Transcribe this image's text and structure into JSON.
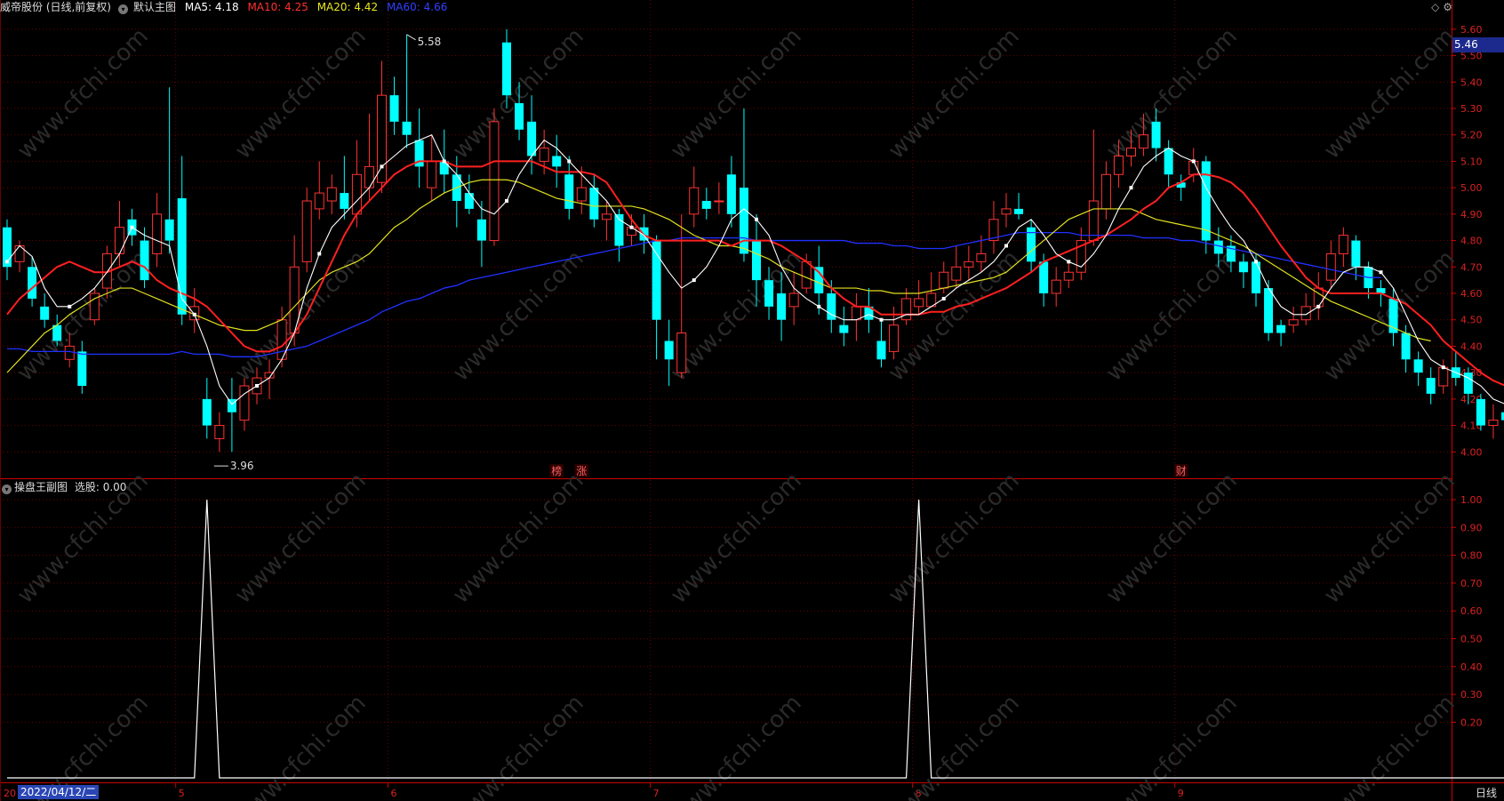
{
  "header": {
    "stock_title": "威帝股份 (日线,前复权)",
    "template": "默认主图",
    "ma5_label": "MA5: 4.18",
    "ma10_label": "MA10: 4.25",
    "ma20_label": "MA20: 4.42",
    "ma60_label": "MA60: 4.66"
  },
  "sub": {
    "title": "操盘王副图",
    "value_label": "选股: 0.00"
  },
  "price_box": "5.46",
  "extremes": {
    "high": "5.58",
    "low": "3.96"
  },
  "events": [
    "榜",
    "涨",
    "财"
  ],
  "date_axis": {
    "selected": "2022/04/12/二",
    "months": [
      "5",
      "6",
      "7",
      "8",
      "9"
    ],
    "left_stub": "20"
  },
  "period": "日线",
  "watermark": "www.cfchi.com",
  "colors": {
    "up": "#ff3333",
    "down": "#00ffff",
    "ma5": "#ffffff",
    "ma10": "#ff2020",
    "ma20": "#e0e020",
    "ma60": "#2030ff",
    "grid": "#6b0000"
  },
  "price_axis": [
    "5.60",
    "5.50",
    "5.40",
    "5.30",
    "5.20",
    "5.10",
    "5.00",
    "4.90",
    "4.80",
    "4.70",
    "4.60",
    "4.50",
    "4.40",
    "4.30",
    "4.20",
    "4.10",
    "4.00"
  ],
  "sub_axis": [
    "1.00",
    "0.90",
    "0.80",
    "0.70",
    "0.60",
    "0.50",
    "0.40",
    "0.30",
    "0.20"
  ],
  "chart_data": {
    "type": "candlestick",
    "ylim": [
      3.9,
      5.65
    ],
    "candles": [
      [
        4.85,
        4.7,
        4.88,
        4.65
      ],
      [
        4.72,
        4.78,
        4.8,
        4.68
      ],
      [
        4.7,
        4.58,
        4.74,
        4.55
      ],
      [
        4.55,
        4.5,
        4.6,
        4.47
      ],
      [
        4.48,
        4.42,
        4.52,
        4.4
      ],
      [
        4.35,
        4.4,
        4.45,
        4.32
      ],
      [
        4.38,
        4.25,
        4.42,
        4.22
      ],
      [
        4.5,
        4.6,
        4.62,
        4.48
      ],
      [
        4.62,
        4.75,
        4.78,
        4.58
      ],
      [
        4.75,
        4.85,
        4.95,
        4.7
      ],
      [
        4.88,
        4.82,
        4.92,
        4.78
      ],
      [
        4.8,
        4.65,
        4.85,
        4.62
      ],
      [
        4.75,
        4.9,
        4.98,
        4.7
      ],
      [
        4.88,
        4.8,
        5.38,
        4.75
      ],
      [
        4.96,
        4.52,
        5.12,
        4.48
      ],
      [
        4.5,
        4.55,
        4.62,
        4.45
      ],
      [
        4.2,
        4.1,
        4.28,
        4.05
      ],
      [
        4.05,
        4.1,
        4.15,
        4.0
      ],
      [
        4.2,
        4.15,
        4.28,
        4.0
      ],
      [
        4.12,
        4.25,
        4.28,
        4.08
      ],
      [
        4.22,
        4.28,
        4.32,
        4.18
      ],
      [
        4.28,
        4.3,
        4.35,
        4.2
      ],
      [
        4.35,
        4.5,
        4.55,
        4.32
      ],
      [
        4.45,
        4.7,
        4.82,
        4.4
      ],
      [
        4.72,
        4.95,
        5.0,
        4.68
      ],
      [
        4.92,
        4.98,
        5.1,
        4.88
      ],
      [
        4.95,
        5.0,
        5.05,
        4.9
      ],
      [
        4.98,
        4.92,
        5.12,
        4.88
      ],
      [
        4.9,
        5.05,
        5.18,
        4.85
      ],
      [
        5.0,
        5.08,
        5.28,
        4.95
      ],
      [
        5.02,
        5.35,
        5.48,
        4.98
      ],
      [
        5.35,
        5.25,
        5.42,
        5.2
      ],
      [
        5.25,
        5.2,
        5.58,
        5.15
      ],
      [
        5.18,
        5.08,
        5.3,
        5.0
      ],
      [
        5.0,
        5.1,
        5.2,
        4.95
      ],
      [
        5.1,
        5.05,
        5.22,
        4.98
      ],
      [
        5.05,
        4.95,
        5.12,
        4.85
      ],
      [
        4.98,
        4.92,
        5.05,
        4.9
      ],
      [
        4.88,
        4.8,
        4.95,
        4.7
      ],
      [
        4.8,
        5.25,
        5.3,
        4.78
      ],
      [
        5.55,
        5.35,
        5.6,
        5.3
      ],
      [
        5.32,
        5.22,
        5.4,
        5.18
      ],
      [
        5.25,
        5.12,
        5.35,
        5.05
      ],
      [
        5.1,
        5.15,
        5.22,
        5.05
      ],
      [
        5.12,
        5.08,
        5.2,
        5.0
      ],
      [
        5.05,
        4.92,
        5.12,
        4.88
      ],
      [
        4.95,
        5.0,
        5.08,
        4.9
      ],
      [
        5.0,
        4.88,
        5.05,
        4.85
      ],
      [
        4.88,
        4.9,
        4.95,
        4.8
      ],
      [
        4.9,
        4.78,
        4.92,
        4.72
      ],
      [
        4.82,
        4.85,
        4.9,
        4.78
      ],
      [
        4.85,
        4.8,
        4.9,
        4.75
      ],
      [
        4.8,
        4.5,
        4.82,
        4.35
      ],
      [
        4.42,
        4.35,
        4.5,
        4.25
      ],
      [
        4.3,
        4.45,
        4.9,
        4.28
      ],
      [
        4.9,
        5.0,
        5.08,
        4.85
      ],
      [
        4.95,
        4.92,
        5.0,
        4.88
      ],
      [
        4.95,
        4.95,
        5.02,
        4.9
      ],
      [
        5.05,
        4.9,
        5.12,
        4.85
      ],
      [
        5.0,
        4.75,
        5.3,
        4.72
      ],
      [
        4.8,
        4.65,
        4.9,
        4.55
      ],
      [
        4.65,
        4.55,
        4.7,
        4.5
      ],
      [
        4.6,
        4.5,
        4.68,
        4.42
      ],
      [
        4.55,
        4.6,
        4.68,
        4.48
      ],
      [
        4.62,
        4.72,
        4.75,
        4.6
      ],
      [
        4.7,
        4.6,
        4.78,
        4.52
      ],
      [
        4.6,
        4.5,
        4.65,
        4.45
      ],
      [
        4.48,
        4.45,
        4.55,
        4.4
      ],
      [
        4.5,
        4.55,
        4.6,
        4.42
      ],
      [
        4.55,
        4.5,
        4.62,
        4.45
      ],
      [
        4.42,
        4.35,
        4.5,
        4.32
      ],
      [
        4.38,
        4.48,
        4.55,
        4.35
      ],
      [
        4.5,
        4.58,
        4.62,
        4.48
      ],
      [
        4.55,
        4.58,
        4.65,
        4.52
      ],
      [
        4.55,
        4.6,
        4.68,
        4.55
      ],
      [
        4.62,
        4.68,
        4.72,
        4.6
      ],
      [
        4.65,
        4.7,
        4.78,
        4.62
      ],
      [
        4.7,
        4.72,
        4.78,
        4.65
      ],
      [
        4.72,
        4.75,
        4.82,
        4.68
      ],
      [
        4.8,
        4.88,
        4.95,
        4.75
      ],
      [
        4.9,
        4.92,
        4.98,
        4.85
      ],
      [
        4.92,
        4.9,
        4.98,
        4.88
      ],
      [
        4.85,
        4.72,
        4.88,
        4.68
      ],
      [
        4.72,
        4.6,
        4.75,
        4.55
      ],
      [
        4.6,
        4.65,
        4.7,
        4.55
      ],
      [
        4.65,
        4.68,
        4.72,
        4.62
      ],
      [
        4.68,
        4.8,
        4.85,
        4.65
      ],
      [
        4.8,
        4.95,
        5.22,
        4.78
      ],
      [
        4.92,
        5.05,
        5.1,
        4.88
      ],
      [
        5.05,
        5.12,
        5.18,
        5.0
      ],
      [
        5.12,
        5.15,
        5.22,
        5.08
      ],
      [
        5.15,
        5.2,
        5.28,
        5.12
      ],
      [
        5.25,
        5.15,
        5.3,
        5.1
      ],
      [
        5.15,
        5.05,
        5.18,
        5.0
      ],
      [
        5.02,
        5.0,
        5.05,
        4.95
      ],
      [
        5.05,
        5.1,
        5.15,
        5.02
      ],
      [
        5.1,
        4.8,
        5.12,
        4.75
      ],
      [
        4.8,
        4.75,
        4.85,
        4.7
      ],
      [
        4.78,
        4.72,
        4.82,
        4.68
      ],
      [
        4.72,
        4.68,
        4.75,
        4.62
      ],
      [
        4.72,
        4.6,
        4.75,
        4.55
      ],
      [
        4.62,
        4.45,
        4.65,
        4.42
      ],
      [
        4.48,
        4.45,
        4.5,
        4.4
      ],
      [
        4.48,
        4.5,
        4.55,
        4.45
      ],
      [
        4.5,
        4.55,
        4.6,
        4.48
      ],
      [
        4.55,
        4.62,
        4.68,
        4.5
      ],
      [
        4.65,
        4.75,
        4.8,
        4.62
      ],
      [
        4.75,
        4.82,
        4.85,
        4.7
      ],
      [
        4.8,
        4.7,
        4.82,
        4.65
      ],
      [
        4.7,
        4.62,
        4.72,
        4.58
      ],
      [
        4.62,
        4.6,
        4.65,
        4.55
      ],
      [
        4.58,
        4.45,
        4.62,
        4.4
      ],
      [
        4.45,
        4.35,
        4.48,
        4.3
      ],
      [
        4.35,
        4.3,
        4.38,
        4.25
      ],
      [
        4.28,
        4.22,
        4.32,
        4.18
      ],
      [
        4.25,
        4.32,
        4.35,
        4.22
      ],
      [
        4.32,
        4.28,
        4.38,
        4.25
      ],
      [
        4.3,
        4.22,
        4.32,
        4.18
      ],
      [
        4.2,
        4.1,
        4.22,
        4.08
      ],
      [
        4.1,
        4.12,
        4.18,
        4.05
      ],
      [
        4.15,
        4.12,
        4.18,
        4.1
      ]
    ],
    "ma5": [
      4.72,
      4.78,
      4.74,
      4.62,
      4.55,
      4.55,
      4.58,
      4.62,
      4.68,
      4.75,
      4.85,
      4.82,
      4.8,
      4.78,
      4.58,
      4.52,
      4.4,
      4.25,
      4.18,
      4.22,
      4.25,
      4.28,
      4.35,
      4.45,
      4.62,
      4.75,
      4.85,
      4.9,
      4.95,
      5.0,
      5.08,
      5.12,
      5.16,
      5.18,
      5.2,
      5.1,
      5.05,
      4.98,
      4.92,
      4.9,
      4.95,
      5.05,
      5.12,
      5.18,
      5.15,
      5.1,
      5.05,
      5.0,
      4.95,
      4.88,
      4.85,
      4.82,
      4.75,
      4.68,
      4.62,
      4.65,
      4.7,
      4.78,
      4.88,
      4.92,
      4.88,
      4.82,
      4.7,
      4.62,
      4.58,
      4.55,
      4.52,
      4.5,
      4.5,
      4.52,
      4.5,
      4.5,
      4.52,
      4.52,
      4.55,
      4.58,
      4.62,
      4.65,
      4.68,
      4.72,
      4.78,
      4.85,
      4.88,
      4.82,
      4.75,
      4.72,
      4.7,
      4.75,
      4.82,
      4.92,
      5.0,
      5.08,
      5.12,
      5.15,
      5.12,
      5.1,
      5.0,
      4.92,
      4.85,
      4.8,
      4.72,
      4.62,
      4.55,
      4.52,
      4.52,
      4.55,
      4.62,
      4.68,
      4.7,
      4.7,
      4.68,
      4.62,
      4.52,
      4.42,
      4.35,
      4.32,
      4.3,
      4.28,
      4.25,
      4.2,
      4.18
    ],
    "ma10": [
      4.52,
      4.58,
      4.62,
      4.66,
      4.7,
      4.72,
      4.7,
      4.68,
      4.68,
      4.7,
      4.72,
      4.7,
      4.65,
      4.62,
      4.6,
      4.58,
      4.55,
      4.5,
      4.45,
      4.4,
      4.38,
      4.38,
      4.4,
      4.45,
      4.52,
      4.62,
      4.72,
      4.82,
      4.9,
      4.95,
      5.0,
      5.05,
      5.08,
      5.1,
      5.1,
      5.1,
      5.08,
      5.08,
      5.08,
      5.1,
      5.1,
      5.1,
      5.1,
      5.08,
      5.06,
      5.06,
      5.06,
      5.05,
      5.02,
      4.95,
      4.88,
      4.82,
      4.8,
      4.8,
      4.8,
      4.8,
      4.8,
      4.8,
      4.78,
      4.8,
      4.8,
      4.8,
      4.78,
      4.75,
      4.72,
      4.68,
      4.62,
      4.58,
      4.55,
      4.55,
      4.52,
      4.52,
      4.52,
      4.52,
      4.53,
      4.53,
      4.55,
      4.56,
      4.58,
      4.6,
      4.62,
      4.65,
      4.68,
      4.72,
      4.74,
      4.76,
      4.78,
      4.8,
      4.82,
      4.85,
      4.88,
      4.92,
      4.95,
      5.0,
      5.02,
      5.05,
      5.05,
      5.04,
      5.02,
      4.98,
      4.92,
      4.85,
      4.78,
      4.72,
      4.66,
      4.62,
      4.6,
      4.6,
      4.6,
      4.6,
      4.6,
      4.58,
      4.56,
      4.52,
      4.48,
      4.42,
      4.38,
      4.34,
      4.3,
      4.27,
      4.25
    ],
    "ma20": [
      4.3,
      4.35,
      4.4,
      4.45,
      4.48,
      4.52,
      4.55,
      4.58,
      4.6,
      4.62,
      4.62,
      4.6,
      4.58,
      4.56,
      4.54,
      4.52,
      4.5,
      4.48,
      4.47,
      4.46,
      4.46,
      4.48,
      4.5,
      4.55,
      4.6,
      4.65,
      4.68,
      4.7,
      4.72,
      4.75,
      4.8,
      4.85,
      4.88,
      4.92,
      4.95,
      4.98,
      5.0,
      5.02,
      5.03,
      5.03,
      5.03,
      5.02,
      5.0,
      4.98,
      4.96,
      4.95,
      4.94,
      4.93,
      4.93,
      4.93,
      4.93,
      4.92,
      4.9,
      4.88,
      4.85,
      4.82,
      4.8,
      4.78,
      4.78,
      4.77,
      4.75,
      4.73,
      4.7,
      4.68,
      4.66,
      4.64,
      4.62,
      4.62,
      4.62,
      4.61,
      4.61,
      4.6,
      4.6,
      4.6,
      4.61,
      4.62,
      4.63,
      4.64,
      4.65,
      4.66,
      4.68,
      4.72,
      4.76,
      4.8,
      4.84,
      4.88,
      4.9,
      4.92,
      4.92,
      4.92,
      4.92,
      4.9,
      4.88,
      4.87,
      4.86,
      4.85,
      4.84,
      4.82,
      4.8,
      4.78,
      4.75,
      4.72,
      4.69,
      4.66,
      4.63,
      4.6,
      4.57,
      4.55,
      4.53,
      4.51,
      4.49,
      4.47,
      4.45,
      4.43,
      4.42
    ],
    "ma60": [
      4.39,
      4.39,
      4.38,
      4.38,
      4.38,
      4.38,
      4.37,
      4.37,
      4.37,
      4.37,
      4.37,
      4.37,
      4.37,
      4.37,
      4.38,
      4.37,
      4.37,
      4.37,
      4.36,
      4.36,
      4.36,
      4.37,
      4.38,
      4.39,
      4.4,
      4.42,
      4.44,
      4.46,
      4.48,
      4.5,
      4.53,
      4.55,
      4.57,
      4.58,
      4.6,
      4.62,
      4.63,
      4.65,
      4.66,
      4.67,
      4.68,
      4.69,
      4.7,
      4.71,
      4.72,
      4.73,
      4.74,
      4.75,
      4.76,
      4.77,
      4.78,
      4.79,
      4.8,
      4.8,
      4.81,
      4.81,
      4.81,
      4.81,
      4.81,
      4.81,
      4.8,
      4.8,
      4.8,
      4.8,
      4.8,
      4.8,
      4.8,
      4.8,
      4.79,
      4.79,
      4.79,
      4.78,
      4.78,
      4.77,
      4.77,
      4.77,
      4.78,
      4.79,
      4.8,
      4.81,
      4.82,
      4.83,
      4.83,
      4.83,
      4.83,
      4.83,
      4.82,
      4.82,
      4.82,
      4.82,
      4.82,
      4.81,
      4.81,
      4.81,
      4.8,
      4.8,
      4.79,
      4.78,
      4.77,
      4.76,
      4.75,
      4.74,
      4.73,
      4.72,
      4.71,
      4.7,
      4.69,
      4.68,
      4.67,
      4.66,
      4.66
    ],
    "signal_peaks": [
      16,
      73
    ]
  }
}
